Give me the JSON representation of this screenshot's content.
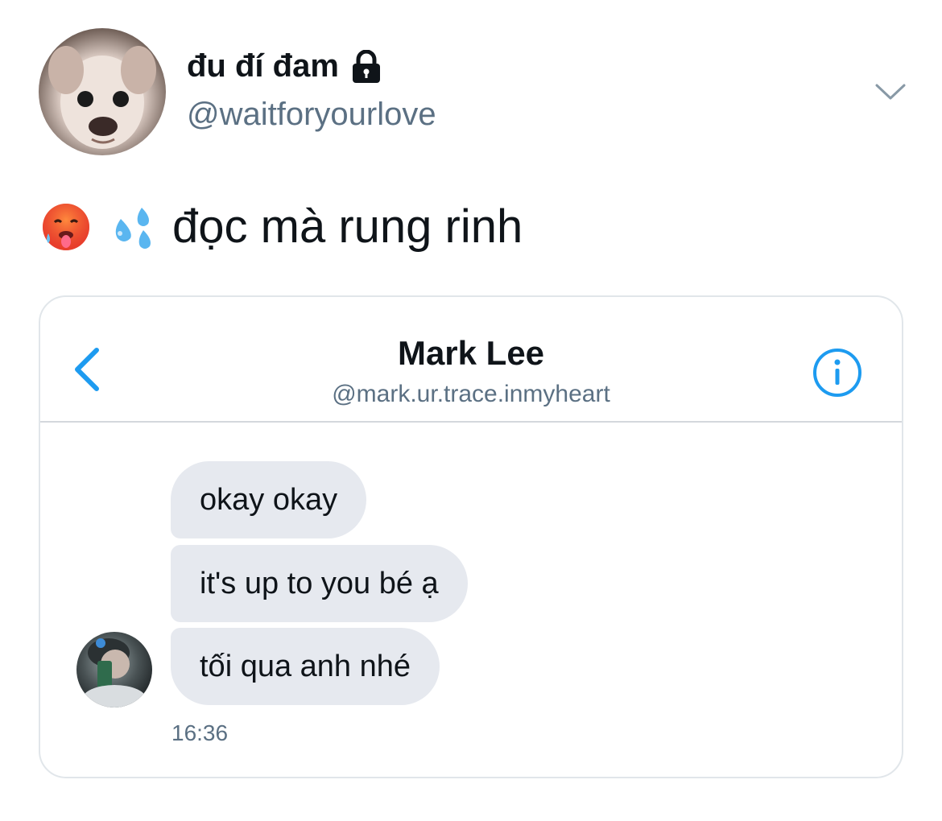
{
  "tweet": {
    "display_name": "đu đí đam",
    "protected_icon": "lock-icon",
    "username": "@waitforyourlove",
    "menu_icon": "chevron-down-icon",
    "text": "đọc mà rung rinh",
    "emojis": [
      "hot-face-emoji",
      "sweat-droplets-emoji"
    ]
  },
  "dm_card": {
    "name": "Mark Lee",
    "handle": "@mark.ur.trace.inmyheart",
    "back_icon": "chevron-left-icon",
    "info_icon": "info-icon",
    "messages": [
      "okay okay",
      "it's up to you bé ạ",
      "tối qua anh nhé"
    ],
    "timestamp": "16:36"
  },
  "colors": {
    "accent": "#1d9bf0",
    "text_primary": "#0f1419",
    "text_secondary": "#5b7083",
    "bubble": "#e6e9ef",
    "border": "#e1e6ea"
  }
}
